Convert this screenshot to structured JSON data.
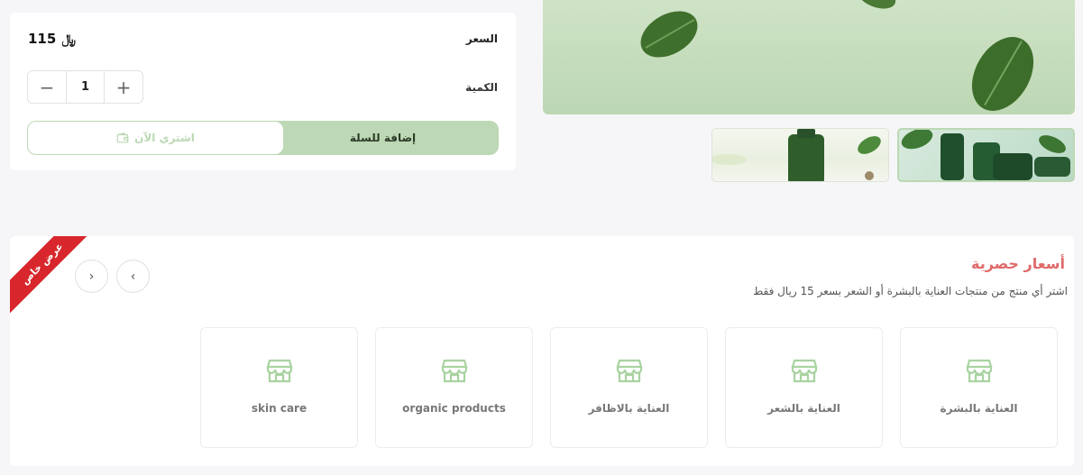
{
  "product": {
    "price_label": "السعر",
    "price_value": "115",
    "currency_symbol": "﷼",
    "quantity_label": "الكمية",
    "quantity_value": "1",
    "minus_symbol": "−",
    "plus_symbol": "+",
    "add_to_cart_label": "إضافة للسلة",
    "buy_now_label": "اشتري الآن"
  },
  "gallery": {
    "thumbnails": 2,
    "selected_thumbnail": 2
  },
  "offers": {
    "ribbon_text": "عرض خاص",
    "title": "أسعار حصرية",
    "subtitle": "اشتر أي منتج من منتجات العناية بالبشرة أو الشعر بسعر 15 ريال فقط",
    "categories": [
      {
        "label": "العناية بالبشرة",
        "icon": "store-icon"
      },
      {
        "label": "العناية بالشعر",
        "icon": "store-icon"
      },
      {
        "label": "العناية بالاظافر",
        "icon": "store-icon"
      },
      {
        "label": "organic products",
        "icon": "store-icon"
      },
      {
        "label": "skin care",
        "icon": "store-icon"
      }
    ]
  },
  "colors": {
    "brand_green": "#bcd8b4",
    "offer_title": "#e06a6a",
    "ribbon_red": "#d8272c"
  }
}
